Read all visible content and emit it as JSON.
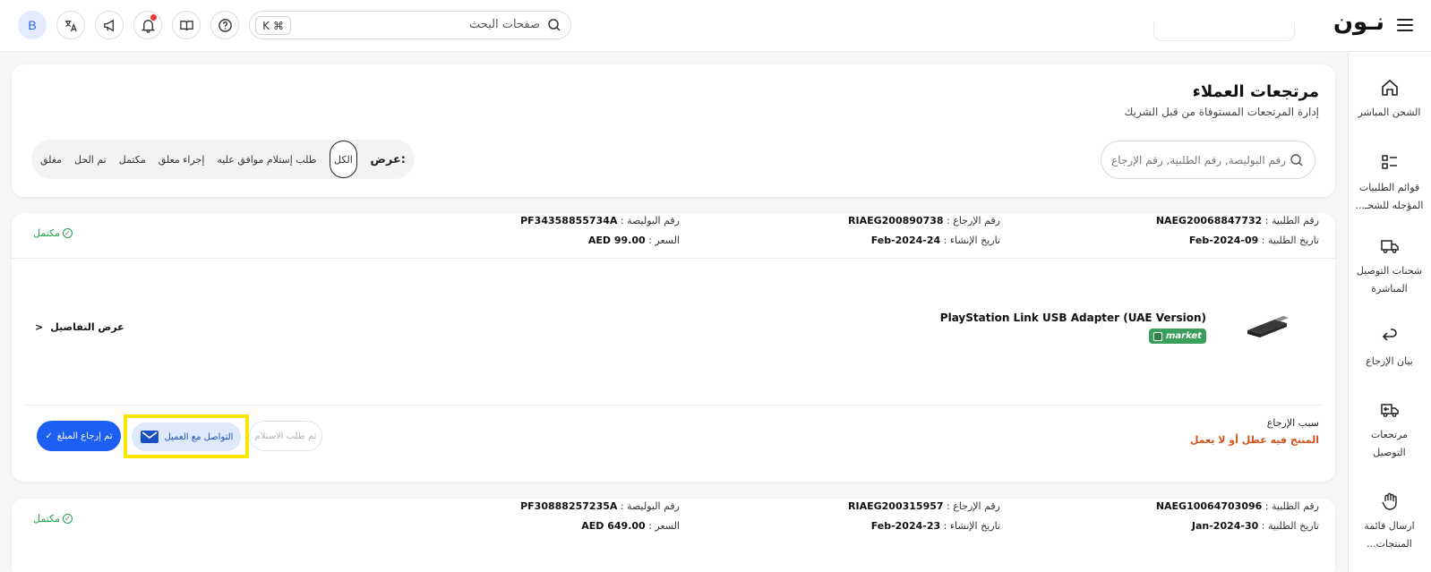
{
  "header": {
    "logo": "نـون",
    "search_placeholder": "صفحات البحث",
    "kbd_key": "K",
    "kbd_mod": "⌘",
    "avatar_initial": "B"
  },
  "sidebar": {
    "items": [
      {
        "label": "الشحن المباشر",
        "icon": "home-icon"
      },
      {
        "label": "قوائم الطلبيات المؤجله للشحـ...",
        "icon": "list-icon"
      },
      {
        "label": "شحنات التوصيل المباشرة",
        "icon": "truck-icon"
      },
      {
        "label": "بيان الإرجاع",
        "icon": "return-arrow-icon"
      },
      {
        "label": "مرتجعات التوصيل",
        "icon": "return-truck-icon"
      },
      {
        "label": "ارسال قائمة المنتجات...",
        "icon": "hand-icon"
      }
    ]
  },
  "page": {
    "title": "مرتجعات العملاء",
    "subtitle": "إدارة المرتجعات المستوفاة من قبل الشريك",
    "search_placeholder": "رقم البوليصة, رقم الطلبية, رقم الإرجاع",
    "filter_label": "عرض:",
    "filters": [
      "الكل",
      "طلب إستلام موافق عليه",
      "إجراء معلق",
      "مكتمل",
      "تم الحل",
      "مغلق"
    ],
    "active_filter": "الكل"
  },
  "orders": [
    {
      "order_no_label": "رقم الطلبية :",
      "order_no": "NAEG20068847732",
      "order_date_label": "تاريخ الطلبية :",
      "order_date": "09-Feb-2024",
      "return_no_label": "رقم الإرجاع :",
      "return_no": "RIAEG200890738",
      "created_label": "تاريخ الإنشاء :",
      "created": "24-Feb-2024",
      "awb_label": "رقم البوليصة :",
      "awb": "PF34358855734A",
      "price_label": "السعر :",
      "price": "AED 99.00",
      "status": "مكتمل",
      "product_name": "PlayStation Link USB Adapter (UAE Version)",
      "badge": "market",
      "details": "عرض التفاصيل",
      "reason_label": "سبب الإرجاع",
      "reason": "المنتج فيه عطل أو لا يعمل",
      "btn_disabled": "تم طلب الاستلام",
      "btn_contact": "التواصل مع العميل",
      "btn_refund": "تم إرجاع المبلغ"
    },
    {
      "order_no_label": "رقم الطلبية :",
      "order_no": "NAEG10064703096",
      "order_date_label": "تاريخ الطلبية :",
      "order_date": "30-Jan-2024",
      "return_no_label": "رقم الإرجاع :",
      "return_no": "RIAEG200315957",
      "created_label": "تاريخ الإنشاء :",
      "created": "23-Feb-2024",
      "awb_label": "رقم البوليصة :",
      "awb": "PF30888257235A",
      "price_label": "السعر :",
      "price": "AED 649.00",
      "status": "مكتمل"
    }
  ],
  "colors": {
    "accent": "#1d5ff2",
    "success": "#22a34a",
    "warning": "#d4531c",
    "highlight": "#fbe600"
  }
}
